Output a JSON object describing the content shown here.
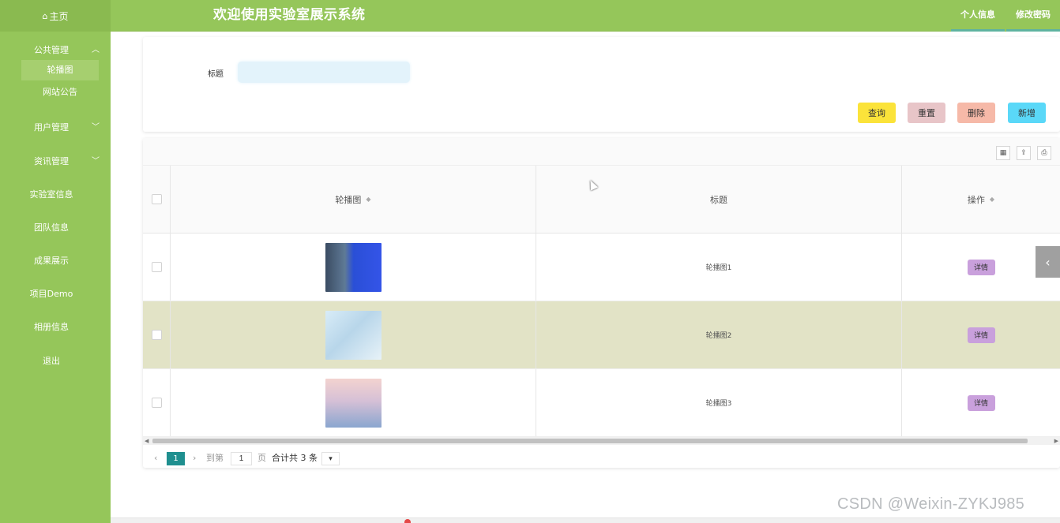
{
  "header": {
    "home_icon": "home-icon",
    "home_label": "主页",
    "app_title": "欢迎使用实验室展示系统",
    "tabs": [
      "个人信息",
      "修改密码"
    ]
  },
  "sidebar": {
    "groups": [
      {
        "label": "公共管理",
        "expanded": true,
        "children": [
          "轮播图",
          "网站公告"
        ]
      },
      {
        "label": "用户管理",
        "expanded": false
      },
      {
        "label": "资讯管理",
        "expanded": false
      }
    ],
    "items": [
      "实验室信息",
      "团队信息",
      "成果展示",
      "项目Demo",
      "相册信息",
      "退出"
    ]
  },
  "search": {
    "label": "标题",
    "value": "",
    "buttons": {
      "query": "查询",
      "reset": "重置",
      "delete": "删除",
      "add": "新增"
    }
  },
  "table": {
    "columns": [
      "轮播图",
      "标题",
      "操作"
    ],
    "rows": [
      {
        "title": "轮播图1",
        "action": "详情"
      },
      {
        "title": "轮播图2",
        "action": "详情"
      },
      {
        "title": "轮播图3",
        "action": "详情"
      }
    ]
  },
  "pagination": {
    "current_page": "1",
    "goto_label": "到第",
    "goto_value": "1",
    "page_unit": "页",
    "total_text": "合计共 3 条"
  },
  "watermark": "CSDN @Weixin-ZYKJ985",
  "colors": {
    "header_bg": "#95c65a",
    "sidebar_bg": "#95c65a",
    "highlight_row": "#e2e3c6",
    "query_btn": "#fbe33a",
    "reset_btn": "#e8c5c8",
    "delete_btn": "#f6b9a8",
    "add_btn": "#5ad8f8",
    "detail_btn": "#c9a0dc",
    "pager_active": "#1f8f8f"
  }
}
